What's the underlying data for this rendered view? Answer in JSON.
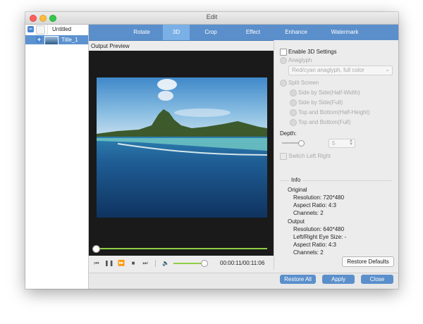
{
  "window": {
    "title": "Edit"
  },
  "sidebar": {
    "items": [
      {
        "label": "Untitled",
        "toggle": "−"
      },
      {
        "label": "Title_1",
        "toggle": "+"
      }
    ]
  },
  "tabs": [
    {
      "label": "Rotate"
    },
    {
      "label": "3D",
      "active": true
    },
    {
      "label": "Crop"
    },
    {
      "label": "Effect"
    },
    {
      "label": "Enhance"
    },
    {
      "label": "Watermark"
    }
  ],
  "preview": {
    "label": "Output Preview",
    "time": "00:00:11/00:11:06",
    "progress_fraction": 0.0,
    "volume_fraction": 0.8
  },
  "settings": {
    "enable_3d_label": "Enable 3D Settings",
    "enable_3d_checked": false,
    "anaglyph_label": "Anaglyph",
    "anaglyph_select_value": "Red/cyan anaglyph, full color",
    "split_screen_label": "Split Screen",
    "split_options": [
      "Side by Side(Half-Width)",
      "Side by Side(Full)",
      "Top and Bottom(Half-Height)",
      "Top and Bottom(Full)"
    ],
    "depth_label": "Depth:",
    "depth_value": "5",
    "switch_label": "Switch Left Right"
  },
  "info": {
    "header": "Info",
    "original_title": "Original",
    "original": [
      "Resolution: 720*480",
      "Aspect Ratio: 4:3",
      "Channels: 2"
    ],
    "output_title": "Output",
    "output": [
      "Resolution: 640*480",
      "Left/Right Eye Size: -",
      "Aspect Ratio: 4:3",
      "Channels: 2"
    ]
  },
  "buttons": {
    "restore_defaults": "Restore Defaults",
    "restore_all": "Restore All",
    "apply": "Apply",
    "close": "Close"
  },
  "icons": {
    "prev": "skip-back-icon",
    "pause": "pause-icon",
    "fast_forward": "fast-forward-icon",
    "stop": "stop-icon",
    "next": "skip-forward-icon",
    "volume": "volume-icon"
  },
  "colors": {
    "accent": "#5b8fcb",
    "tab_active": "#7ab0e6",
    "progress": "#8fd044",
    "selected_row": "#5c92cf"
  }
}
